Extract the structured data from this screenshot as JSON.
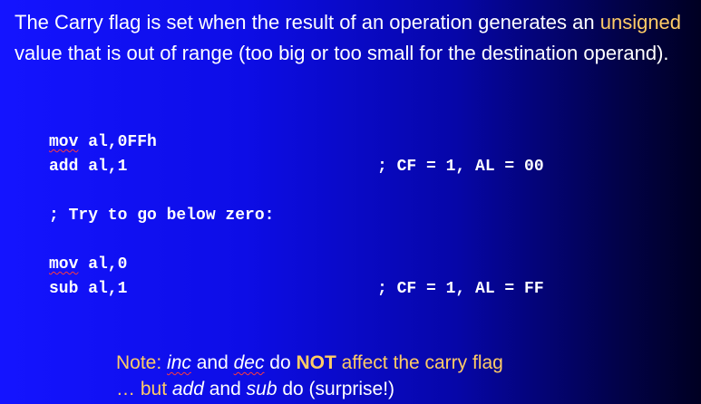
{
  "intro": {
    "part1": "The Carry flag is set when the result of an operation generates an",
    "highlight": "unsigned",
    "part2": " value that is out of range (too big or too small for the destination operand)."
  },
  "code": {
    "block1": {
      "line1_mnemonic": "mov",
      "line1_operands": " al,0FFh",
      "line2": "add al,1",
      "line2_comment": "; CF = 1, AL = 00"
    },
    "comment_line": "; Try to go below zero:",
    "block2": {
      "line1_mnemonic": "mov",
      "line1_operands": " al,0",
      "line2": "sub al,1",
      "line2_comment": "; CF = 1, AL = FF"
    }
  },
  "note": {
    "prefix": "Note: ",
    "inc": "inc",
    "and1": " and ",
    "dec": "dec",
    "do": " do ",
    "not": "NOT",
    "affect": " affect the carry flag",
    "line2_prefix": "… but ",
    "add": "add",
    "and2": " and ",
    "sub": "sub",
    "line2_suffix": " do (surprise!)"
  },
  "colors": {
    "accent": "#ffcc66",
    "text": "#ffffff",
    "bg_start": "#1414ff",
    "bg_end": "#000022"
  }
}
